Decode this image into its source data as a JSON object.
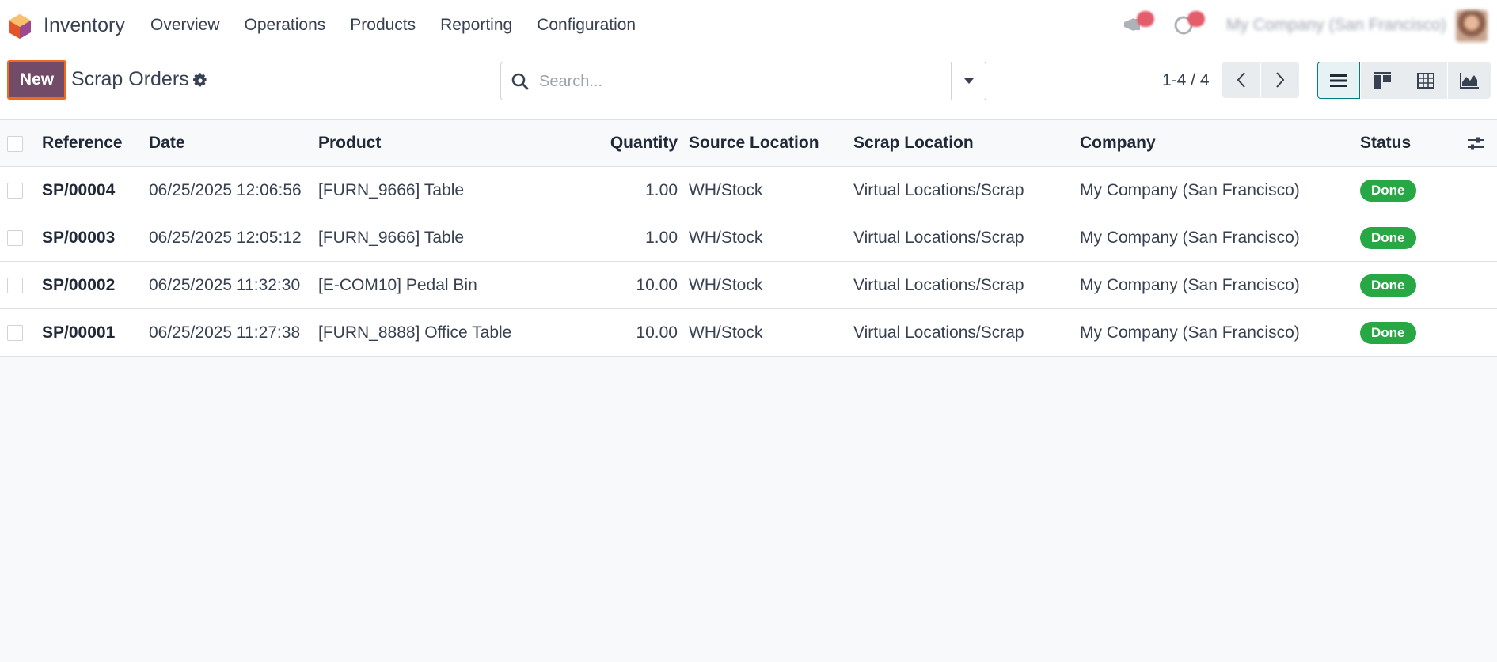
{
  "navbar": {
    "app_name": "Inventory",
    "menu": [
      "Overview",
      "Operations",
      "Products",
      "Reporting",
      "Configuration"
    ],
    "company": "My Company (San Francisco)",
    "messages_badge": "1",
    "activities_badge": "1"
  },
  "control_panel": {
    "new_label": "New",
    "title": "Scrap Orders",
    "search_placeholder": "Search...",
    "pager": "1-4 / 4"
  },
  "table": {
    "headers": {
      "reference": "Reference",
      "date": "Date",
      "product": "Product",
      "quantity": "Quantity",
      "source_location": "Source Location",
      "scrap_location": "Scrap Location",
      "company": "Company",
      "status": "Status"
    },
    "rows": [
      {
        "reference": "SP/00004",
        "date": "06/25/2025 12:06:56",
        "product": "[FURN_9666] Table",
        "quantity": "1.00",
        "source_location": "WH/Stock",
        "scrap_location": "Virtual Locations/Scrap",
        "company": "My Company (San Francisco)",
        "status": "Done"
      },
      {
        "reference": "SP/00003",
        "date": "06/25/2025 12:05:12",
        "product": "[FURN_9666] Table",
        "quantity": "1.00",
        "source_location": "WH/Stock",
        "scrap_location": "Virtual Locations/Scrap",
        "company": "My Company (San Francisco)",
        "status": "Done"
      },
      {
        "reference": "SP/00002",
        "date": "06/25/2025 11:32:30",
        "product": "[E-COM10] Pedal Bin",
        "quantity": "10.00",
        "source_location": "WH/Stock",
        "scrap_location": "Virtual Locations/Scrap",
        "company": "My Company (San Francisco)",
        "status": "Done"
      },
      {
        "reference": "SP/00001",
        "date": "06/25/2025 11:27:38",
        "product": "[FURN_8888] Office Table",
        "quantity": "10.00",
        "source_location": "WH/Stock",
        "scrap_location": "Virtual Locations/Scrap",
        "company": "My Company (San Francisco)",
        "status": "Done"
      }
    ]
  },
  "colors": {
    "brand": "#714b67",
    "highlight": "#f06a1a",
    "status_done": "#28a745",
    "view_active": "#017e84"
  },
  "icons": [
    "odoo-logo-icon",
    "megaphone-icon",
    "clock-icon",
    "gear-icon",
    "search-icon",
    "caret-down-icon",
    "chevron-left-icon",
    "chevron-right-icon",
    "list-view-icon",
    "kanban-view-icon",
    "pivot-view-icon",
    "graph-view-icon",
    "optional-columns-icon"
  ]
}
